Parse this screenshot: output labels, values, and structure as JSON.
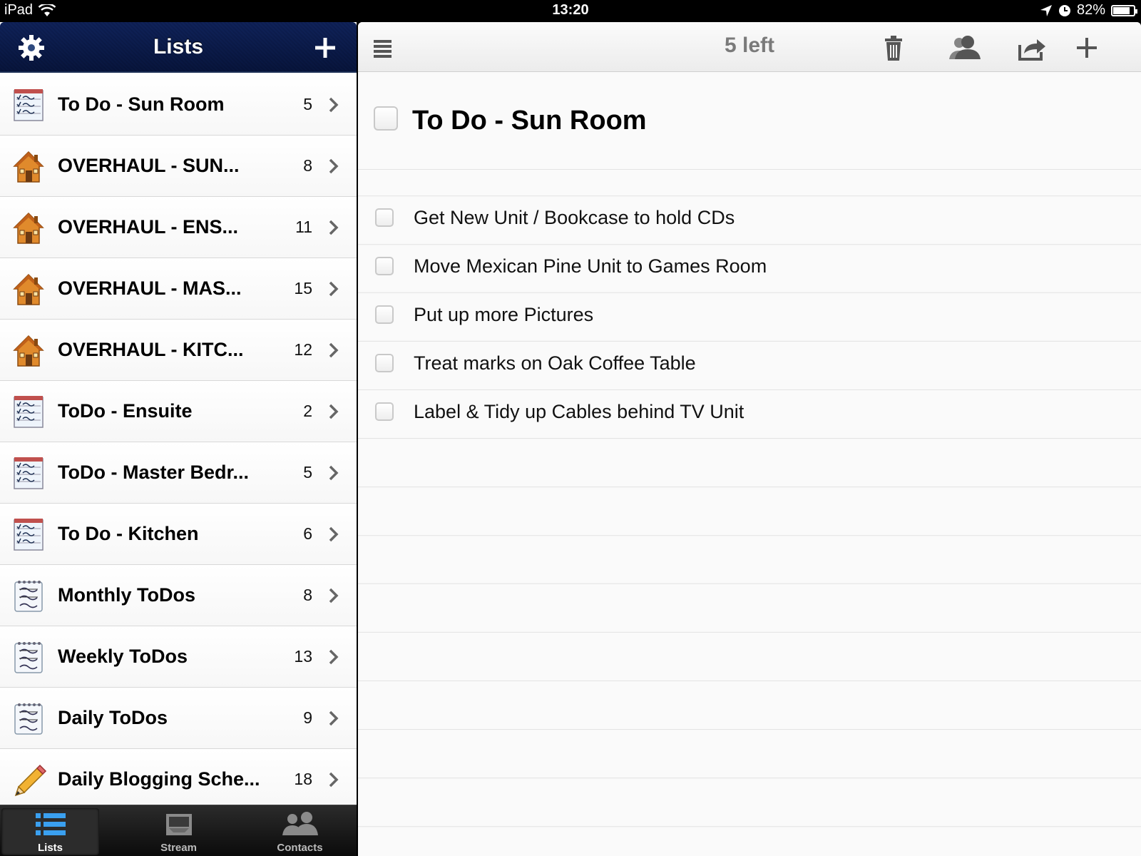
{
  "status_bar": {
    "device": "iPad",
    "time": "13:20",
    "battery": "82%",
    "battery_level": 0.82
  },
  "sidebar": {
    "title": "Lists",
    "items": [
      {
        "label": "To Do - Sun Room",
        "count": "5",
        "icon": "checklist-icon"
      },
      {
        "label": "OVERHAUL  -  SUN...",
        "count": "8",
        "icon": "house-icon"
      },
      {
        "label": "OVERHAUL  -  ENS...",
        "count": "11",
        "icon": "house-icon"
      },
      {
        "label": "OVERHAUL  -  MAS...",
        "count": "15",
        "icon": "house-icon"
      },
      {
        "label": "OVERHAUL  -  KITC...",
        "count": "12",
        "icon": "house-icon"
      },
      {
        "label": "ToDo - Ensuite",
        "count": "2",
        "icon": "checklist-icon"
      },
      {
        "label": "ToDo - Master Bedr...",
        "count": "5",
        "icon": "checklist-icon"
      },
      {
        "label": "To Do  -  Kitchen",
        "count": "6",
        "icon": "checklist-icon"
      },
      {
        "label": "Monthly ToDos",
        "count": "8",
        "icon": "grocery-note-icon"
      },
      {
        "label": "Weekly ToDos",
        "count": "13",
        "icon": "grocery-note-icon"
      },
      {
        "label": "Daily ToDos",
        "count": "9",
        "icon": "grocery-note-icon"
      },
      {
        "label": "Daily Blogging Sche...",
        "count": "18",
        "icon": "pencil-icon"
      }
    ]
  },
  "tabs": [
    {
      "label": "Lists",
      "active": true,
      "icon": "lists-icon"
    },
    {
      "label": "Stream",
      "active": false,
      "icon": "stream-icon"
    },
    {
      "label": "Contacts",
      "active": false,
      "icon": "contacts-icon"
    }
  ],
  "main": {
    "left_count": "5 left",
    "list_title": "To Do - Sun Room",
    "tasks": [
      "Get New Unit / Bookcase to hold CDs",
      "Move Mexican Pine Unit to Games Room",
      "Put up more Pictures",
      "Treat marks on Oak Coffee Table",
      "Label & Tidy up Cables behind TV Unit"
    ]
  }
}
